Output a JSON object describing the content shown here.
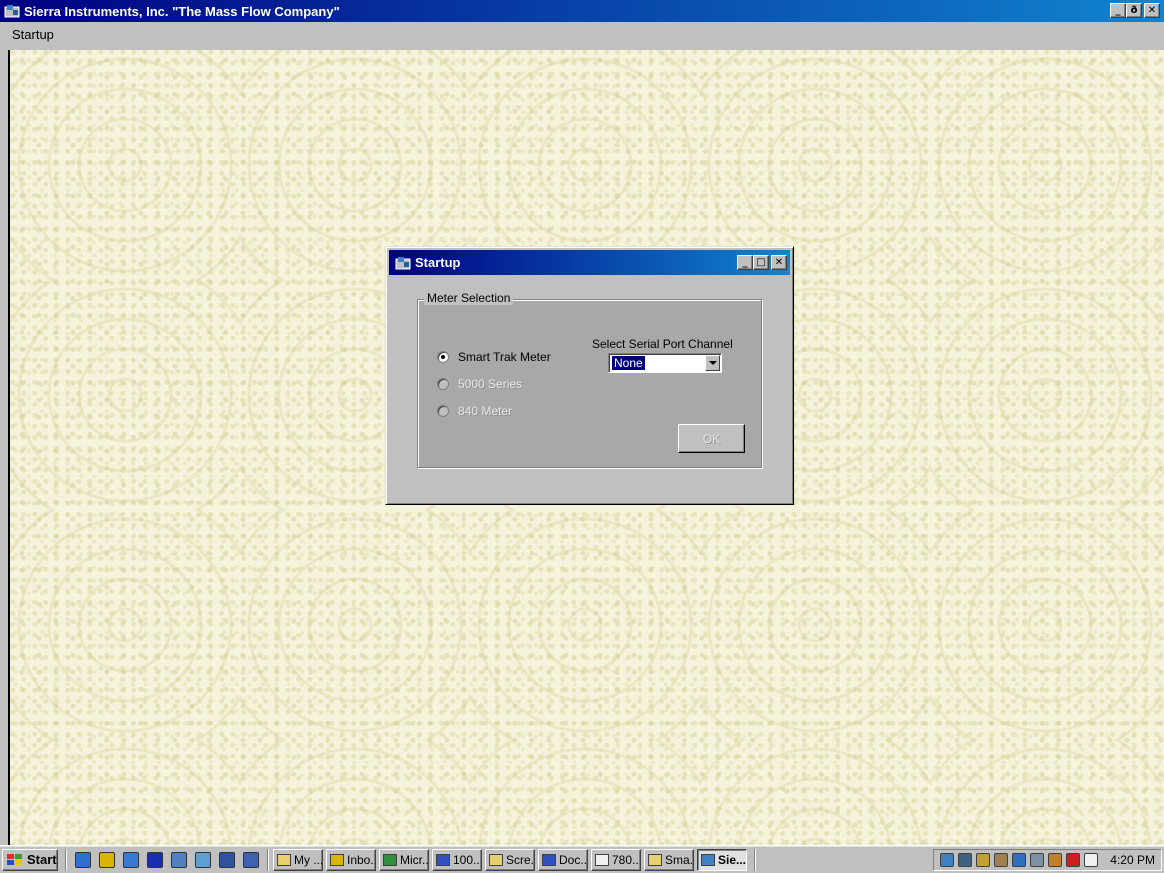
{
  "window": {
    "title": "Sierra Instruments, Inc. \"The Mass Flow Company\"",
    "minimize": "_",
    "maximize": "ð",
    "close": "✕"
  },
  "menubar": {
    "items": [
      "Startup"
    ]
  },
  "dialog": {
    "title": "Startup",
    "minimize": "_",
    "maximize": "□",
    "close": "✕",
    "group_label": "Meter Selection",
    "meters": [
      {
        "label": "Smart Trak Meter",
        "selected": true,
        "enabled": true
      },
      {
        "label": "5000 Series",
        "selected": false,
        "enabled": false
      },
      {
        "label": "840 Meter",
        "selected": false,
        "enabled": false
      }
    ],
    "serial_label": "Select Serial Port Channel",
    "serial_value": "None",
    "ok_label": "OK"
  },
  "taskbar": {
    "start_label": "Start",
    "quick_launch": [
      {
        "icon": "internet-explorer-icon",
        "color": "#2f6fd0"
      },
      {
        "icon": "outlook-icon",
        "color": "#d9b400"
      },
      {
        "icon": "desktop-icon",
        "color": "#3a7ad0"
      },
      {
        "icon": "channels-icon",
        "color": "#1a2fb0"
      },
      {
        "icon": "window-icon",
        "color": "#5080c0"
      },
      {
        "icon": "notepad-icon",
        "color": "#60a0d0"
      },
      {
        "icon": "search-icon",
        "color": "#3050a0"
      },
      {
        "icon": "document-icon",
        "color": "#4060b0"
      }
    ],
    "tasks": [
      {
        "label": "My ...",
        "icon_color": "#e8d070",
        "active": false
      },
      {
        "label": "Inbo...",
        "icon_color": "#d9b400",
        "active": false
      },
      {
        "label": "Micr...",
        "icon_color": "#2f8f3f",
        "active": false
      },
      {
        "label": "100...",
        "icon_color": "#3050c0",
        "active": false
      },
      {
        "label": "Scre...",
        "icon_color": "#e8d070",
        "active": false
      },
      {
        "label": "Doc...",
        "icon_color": "#3050c0",
        "active": false
      },
      {
        "label": "780...",
        "icon_color": "#f0f0f0",
        "active": false
      },
      {
        "label": "Sma...",
        "icon_color": "#e8d070",
        "active": false
      },
      {
        "label": "Sie...",
        "icon_color": "#4080c0",
        "active": true
      }
    ],
    "tray_icons": [
      {
        "icon": "network-icon",
        "color": "#4080c0"
      },
      {
        "icon": "monitor-icon",
        "color": "#406080"
      },
      {
        "icon": "pen-icon",
        "color": "#c0a030"
      },
      {
        "icon": "eraser-icon",
        "color": "#a08050"
      },
      {
        "icon": "shield-icon",
        "color": "#3070c0"
      },
      {
        "icon": "cpu-icon",
        "color": "#8090a0"
      },
      {
        "icon": "speaker-icon",
        "color": "#c08030"
      },
      {
        "icon": "acrobat-icon",
        "color": "#cc2020"
      },
      {
        "icon": "mail-icon",
        "color": "#f0f0f0"
      }
    ],
    "clock": "4:20 PM"
  }
}
